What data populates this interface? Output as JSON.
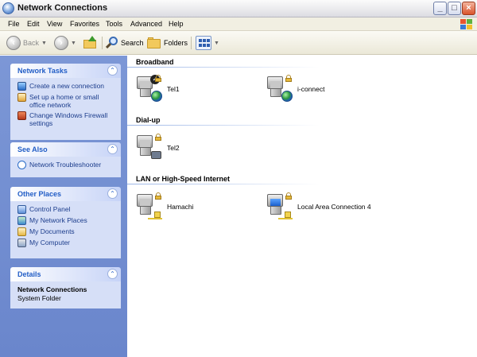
{
  "window": {
    "title": "Network Connections"
  },
  "menu": [
    "File",
    "Edit",
    "View",
    "Favorites",
    "Tools",
    "Advanced",
    "Help"
  ],
  "toolbar": {
    "back": "Back",
    "search": "Search",
    "folders": "Folders"
  },
  "sidebar": {
    "network_tasks": {
      "title": "Network Tasks",
      "items": [
        "Create a new connection",
        "Set up a home or small office network",
        "Change Windows Firewall settings"
      ]
    },
    "see_also": {
      "title": "See Also",
      "items": [
        "Network Troubleshooter"
      ]
    },
    "other_places": {
      "title": "Other Places",
      "items": [
        "Control Panel",
        "My Network Places",
        "My Documents",
        "My Computer"
      ]
    },
    "details": {
      "title": "Details",
      "name": "Network Connections",
      "type": "System Folder"
    }
  },
  "groups": [
    {
      "name": "Broadband",
      "connections": [
        {
          "label": "Tel1",
          "icon": "broadband-connection-icon"
        },
        {
          "label": "i-connect",
          "icon": "broadband-connection-icon"
        }
      ]
    },
    {
      "name": "Dial-up",
      "connections": [
        {
          "label": "Tel2",
          "icon": "dialup-connection-icon"
        }
      ]
    },
    {
      "name": "LAN or High-Speed Internet",
      "connections": [
        {
          "label": "Hamachi",
          "icon": "lan-connection-icon"
        },
        {
          "label": "Local Area Connection 4",
          "icon": "lan-connection-icon"
        }
      ]
    }
  ],
  "colors": {
    "taskpane_bg": "#7c97d6",
    "panel_title": "#215dc6",
    "link_text": "#1c3d8c"
  }
}
